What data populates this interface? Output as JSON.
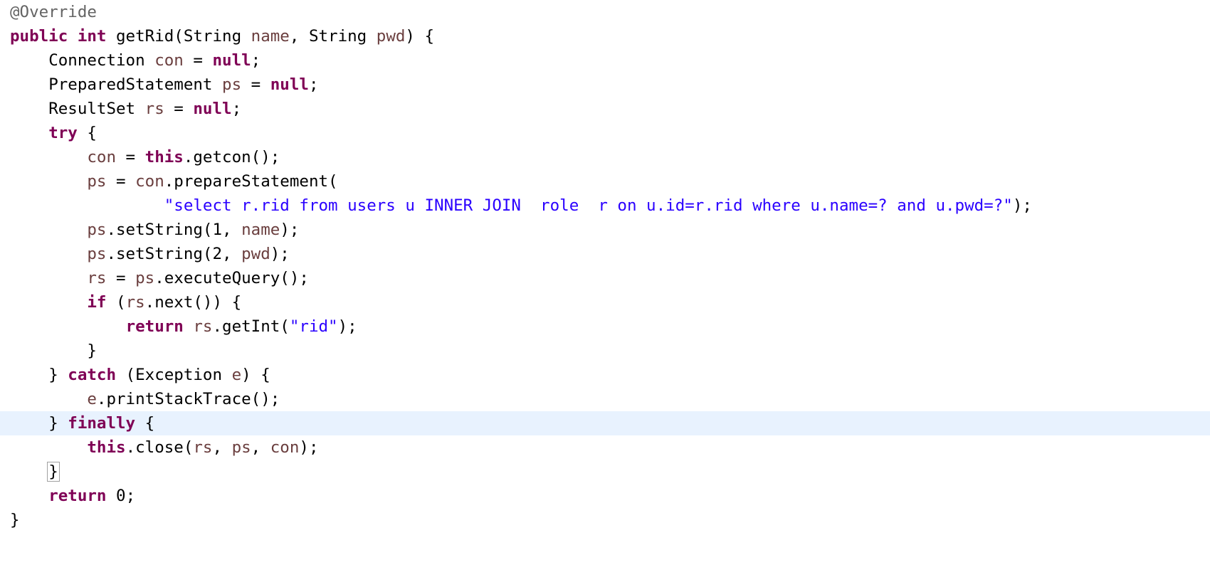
{
  "editor": {
    "language": "java",
    "theme": "eclipse-light",
    "background_color": "#ffffff",
    "current_line_highlight_color": "#E8F2FE",
    "bracket_match_outline_color": "#a0a0a0",
    "token_colors": {
      "keyword": "#7F0055",
      "string": "#2A00FF",
      "annotation": "#646464",
      "parameter": "#6A3E3E",
      "plain": "#000000"
    },
    "highlighted_line_number": 16,
    "bracket_match_line_number": 18
  },
  "code": {
    "lines": [
      {
        "n": 1,
        "indent": 0,
        "highlighted": false,
        "tokens": [
          {
            "t": "anno",
            "s": "@Override"
          }
        ]
      },
      {
        "n": 2,
        "indent": 0,
        "highlighted": false,
        "tokens": [
          {
            "t": "kw",
            "s": "public"
          },
          {
            "t": "plain",
            "s": " "
          },
          {
            "t": "kw",
            "s": "int"
          },
          {
            "t": "plain",
            "s": " getRid(String "
          },
          {
            "t": "param",
            "s": "name"
          },
          {
            "t": "plain",
            "s": ", String "
          },
          {
            "t": "param",
            "s": "pwd"
          },
          {
            "t": "plain",
            "s": ") {"
          }
        ]
      },
      {
        "n": 3,
        "indent": 1,
        "highlighted": false,
        "tokens": [
          {
            "t": "plain",
            "s": "Connection "
          },
          {
            "t": "param",
            "s": "con"
          },
          {
            "t": "plain",
            "s": " = "
          },
          {
            "t": "kw",
            "s": "null"
          },
          {
            "t": "plain",
            "s": ";"
          }
        ]
      },
      {
        "n": 4,
        "indent": 1,
        "highlighted": false,
        "tokens": [
          {
            "t": "plain",
            "s": "PreparedStatement "
          },
          {
            "t": "param",
            "s": "ps"
          },
          {
            "t": "plain",
            "s": " = "
          },
          {
            "t": "kw",
            "s": "null"
          },
          {
            "t": "plain",
            "s": ";"
          }
        ]
      },
      {
        "n": 5,
        "indent": 1,
        "highlighted": false,
        "tokens": [
          {
            "t": "plain",
            "s": "ResultSet "
          },
          {
            "t": "param",
            "s": "rs"
          },
          {
            "t": "plain",
            "s": " = "
          },
          {
            "t": "kw",
            "s": "null"
          },
          {
            "t": "plain",
            "s": ";"
          }
        ]
      },
      {
        "n": 6,
        "indent": 1,
        "highlighted": false,
        "tokens": [
          {
            "t": "kw",
            "s": "try"
          },
          {
            "t": "plain",
            "s": " {"
          }
        ]
      },
      {
        "n": 7,
        "indent": 2,
        "highlighted": false,
        "tokens": [
          {
            "t": "param",
            "s": "con"
          },
          {
            "t": "plain",
            "s": " = "
          },
          {
            "t": "kw",
            "s": "this"
          },
          {
            "t": "plain",
            "s": ".getcon();"
          }
        ]
      },
      {
        "n": 8,
        "indent": 2,
        "highlighted": false,
        "tokens": [
          {
            "t": "param",
            "s": "ps"
          },
          {
            "t": "plain",
            "s": " = "
          },
          {
            "t": "param",
            "s": "con"
          },
          {
            "t": "plain",
            "s": ".prepareStatement("
          }
        ]
      },
      {
        "n": 9,
        "indent": 4,
        "highlighted": false,
        "tokens": [
          {
            "t": "str",
            "s": "\"select r.rid from users u INNER JOIN  role  r on u.id=r.rid where u.name=? and u.pwd=?\""
          },
          {
            "t": "plain",
            "s": ");"
          }
        ]
      },
      {
        "n": 10,
        "indent": 2,
        "highlighted": false,
        "tokens": [
          {
            "t": "param",
            "s": "ps"
          },
          {
            "t": "plain",
            "s": ".setString(1, "
          },
          {
            "t": "param",
            "s": "name"
          },
          {
            "t": "plain",
            "s": ");"
          }
        ]
      },
      {
        "n": 11,
        "indent": 2,
        "highlighted": false,
        "tokens": [
          {
            "t": "param",
            "s": "ps"
          },
          {
            "t": "plain",
            "s": ".setString(2, "
          },
          {
            "t": "param",
            "s": "pwd"
          },
          {
            "t": "plain",
            "s": ");"
          }
        ]
      },
      {
        "n": 12,
        "indent": 2,
        "highlighted": false,
        "tokens": [
          {
            "t": "param",
            "s": "rs"
          },
          {
            "t": "plain",
            "s": " = "
          },
          {
            "t": "param",
            "s": "ps"
          },
          {
            "t": "plain",
            "s": ".executeQuery();"
          }
        ]
      },
      {
        "n": 13,
        "indent": 2,
        "highlighted": false,
        "tokens": [
          {
            "t": "kw",
            "s": "if"
          },
          {
            "t": "plain",
            "s": " ("
          },
          {
            "t": "param",
            "s": "rs"
          },
          {
            "t": "plain",
            "s": ".next()) {"
          }
        ]
      },
      {
        "n": 14,
        "indent": 3,
        "highlighted": false,
        "tokens": [
          {
            "t": "kw",
            "s": "return"
          },
          {
            "t": "plain",
            "s": " "
          },
          {
            "t": "param",
            "s": "rs"
          },
          {
            "t": "plain",
            "s": ".getInt("
          },
          {
            "t": "str",
            "s": "\"rid\""
          },
          {
            "t": "plain",
            "s": ");"
          }
        ]
      },
      {
        "n": 15,
        "indent": 2,
        "highlighted": false,
        "tokens": [
          {
            "t": "plain",
            "s": "}"
          }
        ]
      },
      {
        "n": 16,
        "indent": 1,
        "highlighted": false,
        "tokens": [
          {
            "t": "plain",
            "s": "} "
          },
          {
            "t": "kw",
            "s": "catch"
          },
          {
            "t": "plain",
            "s": " (Exception "
          },
          {
            "t": "param",
            "s": "e"
          },
          {
            "t": "plain",
            "s": ") {"
          }
        ]
      },
      {
        "n": 17,
        "indent": 2,
        "highlighted": false,
        "tokens": [
          {
            "t": "param",
            "s": "e"
          },
          {
            "t": "plain",
            "s": ".printStackTrace();"
          }
        ]
      },
      {
        "n": 18,
        "indent": 1,
        "highlighted": true,
        "tokens": [
          {
            "t": "plain",
            "s": "} "
          },
          {
            "t": "kw",
            "s": "finally"
          },
          {
            "t": "plain",
            "s": " {"
          }
        ]
      },
      {
        "n": 19,
        "indent": 2,
        "highlighted": false,
        "tokens": [
          {
            "t": "kw",
            "s": "this"
          },
          {
            "t": "plain",
            "s": ".close("
          },
          {
            "t": "param",
            "s": "rs"
          },
          {
            "t": "plain",
            "s": ", "
          },
          {
            "t": "param",
            "s": "ps"
          },
          {
            "t": "plain",
            "s": ", "
          },
          {
            "t": "param",
            "s": "con"
          },
          {
            "t": "plain",
            "s": ");"
          }
        ]
      },
      {
        "n": 20,
        "indent": 1,
        "highlighted": false,
        "bracket_match": true,
        "tokens": [
          {
            "t": "plain",
            "s": "}"
          }
        ]
      },
      {
        "n": 21,
        "indent": 1,
        "highlighted": false,
        "tokens": [
          {
            "t": "kw",
            "s": "return"
          },
          {
            "t": "plain",
            "s": " "
          },
          {
            "t": "num",
            "s": "0"
          },
          {
            "t": "plain",
            "s": ";"
          }
        ]
      },
      {
        "n": 22,
        "indent": 0,
        "highlighted": false,
        "tokens": [
          {
            "t": "plain",
            "s": "}"
          }
        ]
      }
    ]
  }
}
